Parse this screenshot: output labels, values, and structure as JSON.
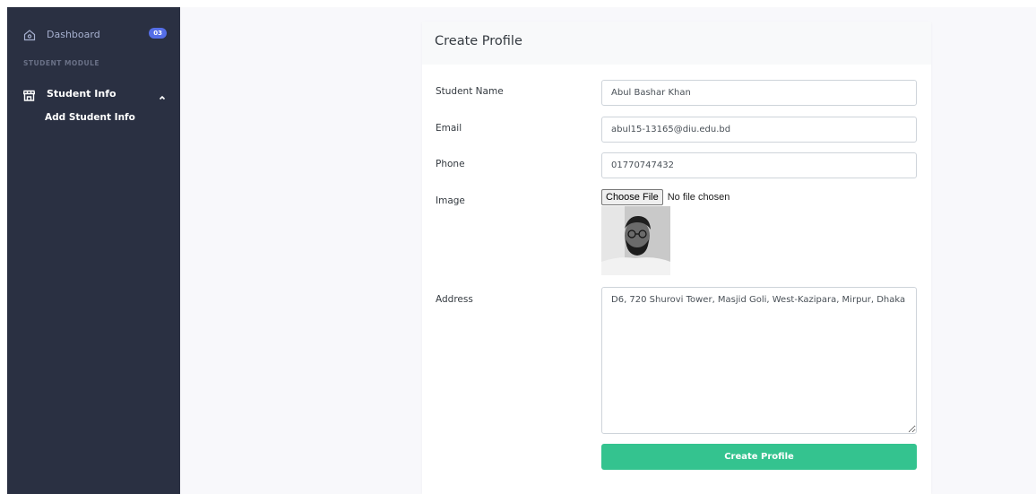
{
  "sidebar": {
    "dashboard": {
      "label": "Dashboard",
      "badge": "03",
      "icon": "home-icon"
    },
    "section_title": "STUDENT MODULE",
    "student_info": {
      "label": "Student Info",
      "icon": "store-icon",
      "expanded": true
    },
    "sub_items": [
      {
        "label": "Add Student Info"
      }
    ]
  },
  "card": {
    "title": "Create Profile"
  },
  "form": {
    "name": {
      "label": "Student Name",
      "value": "Abul Bashar Khan"
    },
    "email": {
      "label": "Email",
      "value": "abul15-13165@diu.edu.bd"
    },
    "phone": {
      "label": "Phone",
      "value": "01770747432"
    },
    "image": {
      "label": "Image",
      "button_label": "Choose File",
      "status": "No file chosen"
    },
    "address": {
      "label": "Address",
      "value": "D6, 720 Shurovi Tower, Masjid Goli, West-Kazipara, Mirpur, Dhaka"
    },
    "submit_label": "Create Profile"
  },
  "colors": {
    "sidebar_bg": "#2a3042",
    "badge": "#556ee6",
    "submit": "#34c38f",
    "page_bg": "#f8f8fb"
  }
}
